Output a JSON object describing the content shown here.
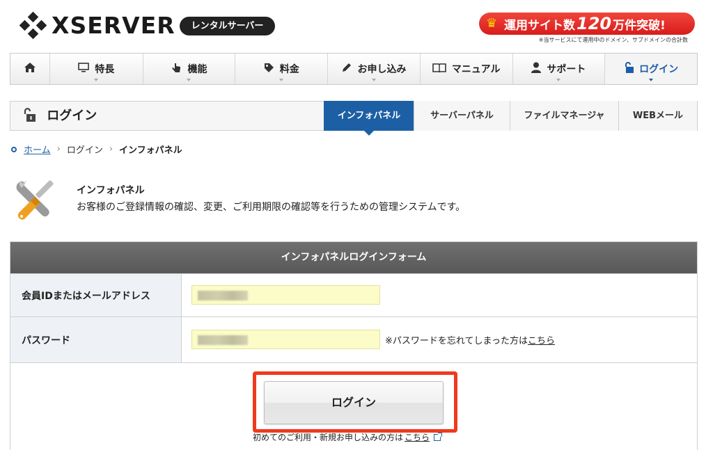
{
  "header": {
    "logo_text": "XSERVER",
    "badge": "レンタルサーバー",
    "promo": {
      "prefix": "運用サイト数",
      "number": "120",
      "suffix": "万件突破!",
      "note": "※当サービスにて運用中のドメイン、サブドメインの合計数"
    }
  },
  "nav": {
    "items": [
      {
        "label": "",
        "icon": "home-icon"
      },
      {
        "label": "特長",
        "icon": "monitor-icon"
      },
      {
        "label": "機能",
        "icon": "pointer-icon"
      },
      {
        "label": "料金",
        "icon": "tag-icon"
      },
      {
        "label": "お申し込み",
        "icon": "pencil-icon"
      },
      {
        "label": "マニュアル",
        "icon": "book-icon"
      },
      {
        "label": "サポート",
        "icon": "person-icon"
      },
      {
        "label": "ログイン",
        "icon": "unlock-icon"
      }
    ]
  },
  "subheader": {
    "title": "ログイン",
    "tabs": [
      "インフォパネル",
      "サーバーパネル",
      "ファイルマネージャ",
      "WEBメール"
    ]
  },
  "breadcrumb": {
    "home": "ホーム",
    "login": "ログイン",
    "current": "インフォパネル"
  },
  "intro": {
    "title": "インフォパネル",
    "description": "お客様のご登録情報の確認、変更、ご利用期限の確認等を行うための管理システムです。"
  },
  "form": {
    "title": "インフォパネルログインフォーム",
    "id_label": "会員IDまたはメールアドレス",
    "password_label": "パスワード",
    "forgot_prefix": "※パスワードを忘れてしまった方は",
    "forgot_link": "こちら",
    "login_button": "ログイン",
    "first_prefix": "初めてのご利用・新規お申し込みの方は",
    "first_link": "こちら"
  },
  "colors": {
    "accent": "#1d5fa5",
    "highlight": "#ef3a1d",
    "input_bg": "#fbfcc8"
  }
}
